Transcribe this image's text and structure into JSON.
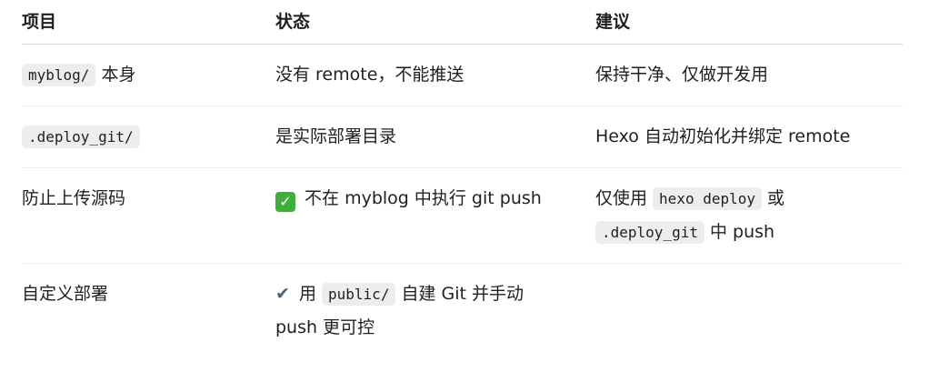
{
  "headers": [
    "项目",
    "状态",
    "建议"
  ],
  "rows": [
    {
      "item_code": "myblog/",
      "item_text": " 本身",
      "status": "没有 remote，不能推送",
      "advice": "保持干净、仅做开发用"
    },
    {
      "item_code": ".deploy_git/",
      "status": "是实际部署目录",
      "advice": "Hexo 自动初始化并绑定 remote"
    },
    {
      "item_text": "防止上传源码",
      "status_icon": "white-check-mark-icon",
      "status_icon_glyph": "✓",
      "status": " 不在 myblog 中执行 git push",
      "advice_pre": "仅使用 ",
      "advice_code1": "hexo deploy",
      "advice_mid": " 或",
      "advice_code2": ".deploy_git",
      "advice_post": " 中 push"
    },
    {
      "item_text": "自定义部署",
      "status_icon": "heavy-check-mark-icon",
      "status_icon_glyph": "✔",
      "status_pre": " 用 ",
      "status_code": "public/",
      "status_mid": " 自建 Git 并手动",
      "status_post": "push 更可控",
      "advice": ""
    }
  ]
}
